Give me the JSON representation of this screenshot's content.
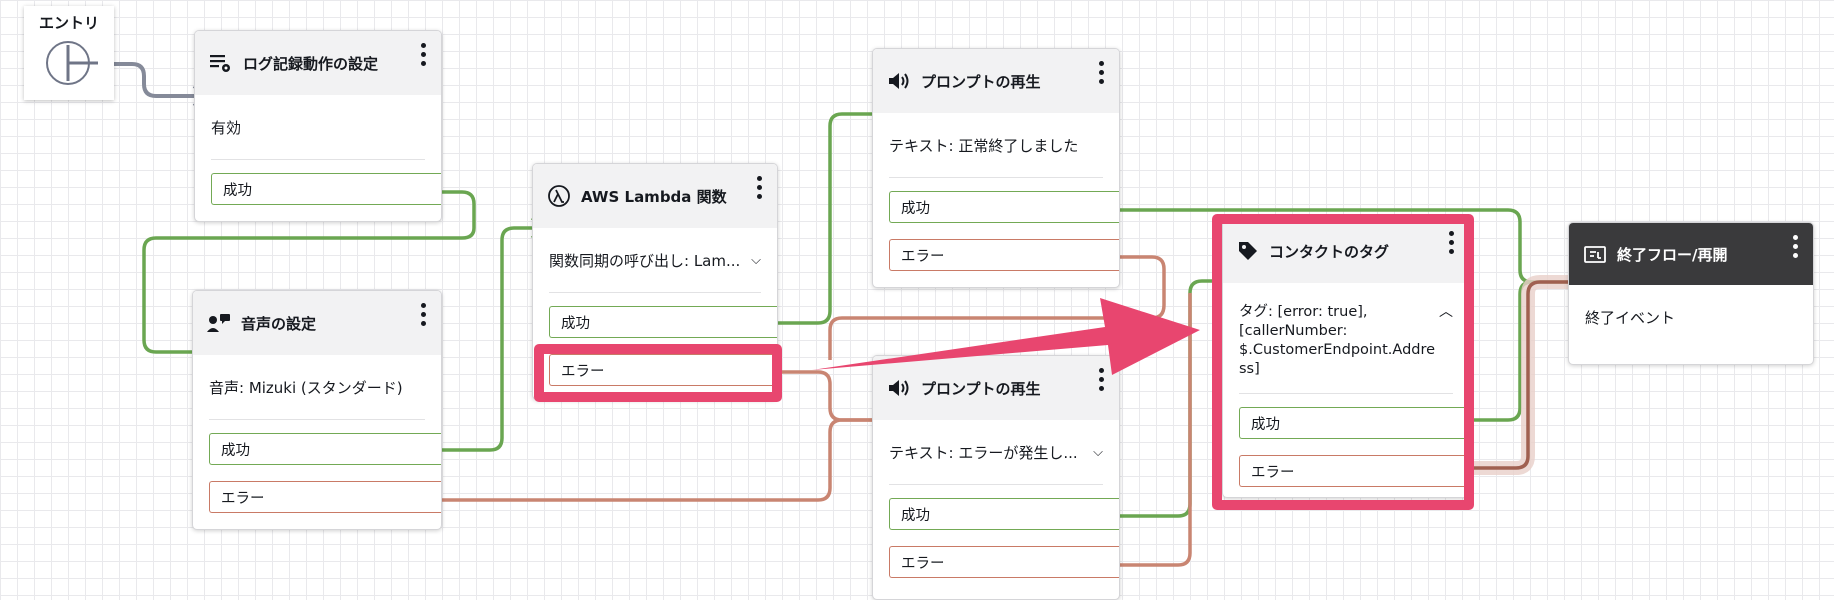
{
  "entry": {
    "label": "エントリ"
  },
  "blocks": {
    "logging": {
      "title": "ログ記録動作の設定",
      "detail": "有効",
      "success": "成功"
    },
    "voice": {
      "title": "音声の設定",
      "detail": "音声: Mizuki (スタンダード)",
      "success": "成功",
      "error": "エラー"
    },
    "lambda": {
      "title": "AWS Lambda 関数",
      "detail": "関数同期の呼び出し: Lam...",
      "success": "成功",
      "error": "エラー"
    },
    "prompt_ok": {
      "title": "プロンプトの再生",
      "detail": "テキスト: 正常終了しました",
      "success": "成功",
      "error": "エラー"
    },
    "prompt_err": {
      "title": "プロンプトの再生",
      "detail": "テキスト: エラーが発生し...",
      "success": "成功",
      "error": "エラー"
    },
    "tag": {
      "title": "コンタクトのタグ",
      "detail_lines": [
        "タグ: [error: true],",
        "[callerNumber:",
        "$.CustomerEndpoint.Addre",
        "ss]"
      ],
      "success": "成功",
      "error": "エラー"
    },
    "end": {
      "title": "終了フロー/再開",
      "detail": "終了イベント"
    }
  },
  "colors": {
    "success_wire": "#6aa651",
    "error_wire": "#c98572",
    "entry_wire": "#858a99",
    "highlight": "#e8466f"
  },
  "icons": {
    "logging": "log-settings-icon",
    "voice": "voice-icon",
    "lambda": "lambda-icon",
    "prompt": "speaker-icon",
    "tag": "tag-icon",
    "end": "end-flow-icon"
  }
}
